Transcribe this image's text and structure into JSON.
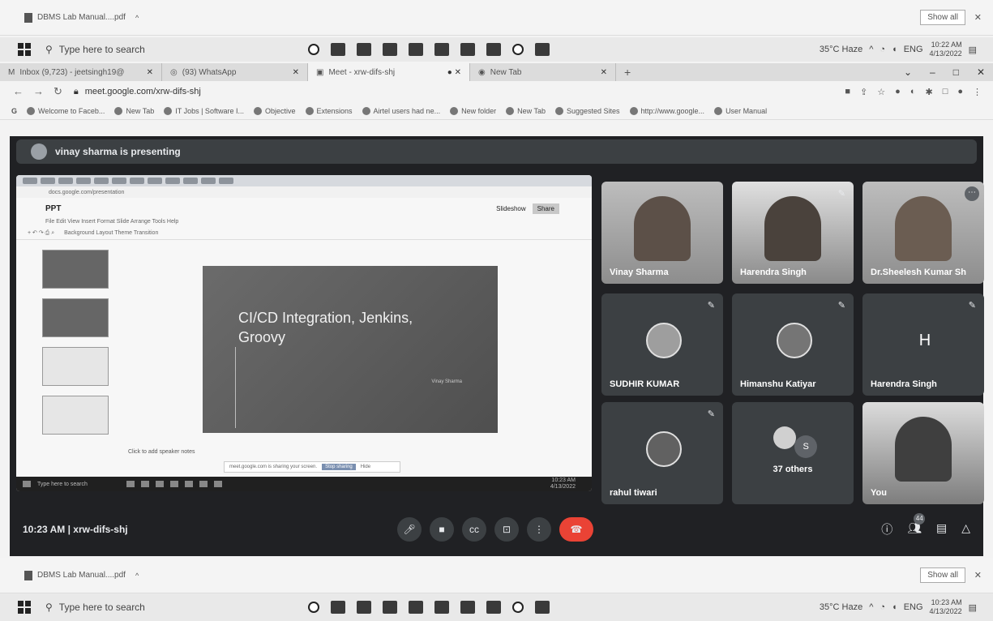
{
  "top_download": {
    "file": "DBMS Lab Manual....pdf",
    "show_all": "Show all"
  },
  "taskbar_top": {
    "search_placeholder": "Type here to search",
    "weather": "35°C  Haze",
    "lang": "ENG",
    "time": "10:22 AM",
    "date": "4/13/2022"
  },
  "tabs": [
    {
      "label": "Inbox (9,723) - jeetsingh19@"
    },
    {
      "label": "(93) WhatsApp"
    },
    {
      "label": "Meet - xrw-difs-shj"
    },
    {
      "label": "New Tab"
    }
  ],
  "address": {
    "url": "meet.google.com/xrw-difs-shj"
  },
  "bookmarks": [
    "Welcome to Faceb...",
    "New Tab",
    "IT Jobs | Software I...",
    "Objective",
    "Extensions",
    "Airtel users had ne...",
    "New folder",
    "New Tab",
    "Suggested Sites",
    "http://www.google...",
    "User Manual"
  ],
  "presenting": {
    "text": "vinay sharma is presenting"
  },
  "shared": {
    "doc_title": "PPT",
    "menu": "File  Edit  View  Insert  Format  Slide  Arrange  Tools  Help",
    "toolbar": "Background    Layout    Theme    Transition",
    "slideshow": "Slideshow",
    "share": "Share",
    "slide_title": "CI/CD Integration, Jenkins, Groovy",
    "slide_author": "Vinay Sharma",
    "speaker_notes": "Click to add speaker notes",
    "share_note": "meet.google.com is sharing your screen.",
    "stop_sharing": "Stop sharing",
    "hide": "Hide",
    "taskbar_search": "Type here to search",
    "taskbar_time": "10:23 AM",
    "taskbar_date": "4/13/2022"
  },
  "participants": [
    {
      "name": "Vinay Sharma"
    },
    {
      "name": "Harendra Singh"
    },
    {
      "name": "Dr.Sheelesh Kumar Sh"
    },
    {
      "name": "SUDHIR KUMAR"
    },
    {
      "name": "Himanshu Katiyar"
    },
    {
      "name": "Harendra Singh",
      "letter": "H"
    },
    {
      "name": "rahul tiwari"
    },
    {
      "name": "37 others",
      "initial": "S"
    },
    {
      "name": "You"
    }
  ],
  "meet_bottom": {
    "time": "10:23 AM  |  xrw-difs-shj",
    "people_count": "44"
  },
  "bottom_download": {
    "file": "DBMS Lab Manual....pdf",
    "show_all": "Show all"
  },
  "taskbar_bottom": {
    "search_placeholder": "Type here to search",
    "weather": "35°C  Haze",
    "lang": "ENG",
    "time": "10:23 AM",
    "date": "4/13/2022"
  }
}
